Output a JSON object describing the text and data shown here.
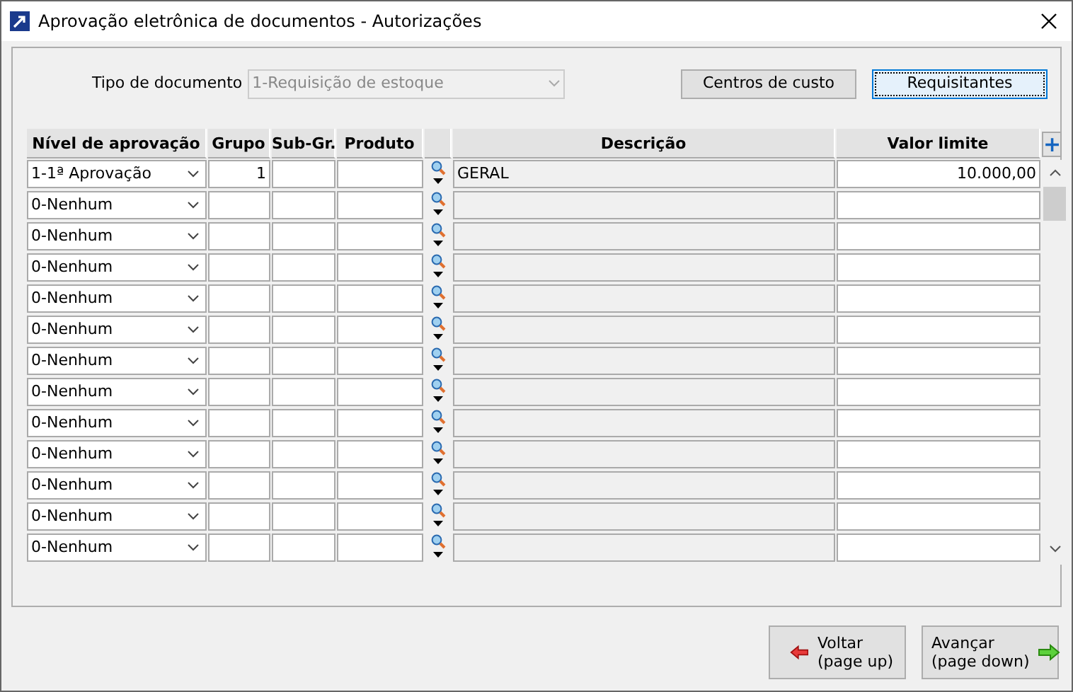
{
  "window": {
    "title": "Aprovação eletrônica de documentos - Autorizações"
  },
  "document_type": {
    "label": "Tipo de documento",
    "value": "1-Requisição de estoque",
    "disabled": true
  },
  "top_buttons": [
    {
      "label": "Centros de custo",
      "focused": false
    },
    {
      "label": "Requisitantes",
      "focused": true
    }
  ],
  "table": {
    "columns": [
      "Nível de aprovação",
      "Grupo",
      "Sub-Gr.",
      "Produto",
      "Descrição",
      "Valor limite"
    ],
    "add_button": "+",
    "rows": [
      {
        "nivel": "1-1ª Aprovação",
        "grupo": "1",
        "subgrupo": "",
        "produto": "",
        "descricao": "GERAL",
        "valor": "10.000,00"
      },
      {
        "nivel": "0-Nenhum"
      },
      {
        "nivel": "0-Nenhum"
      },
      {
        "nivel": "0-Nenhum"
      },
      {
        "nivel": "0-Nenhum"
      },
      {
        "nivel": "0-Nenhum"
      },
      {
        "nivel": "0-Nenhum"
      },
      {
        "nivel": "0-Nenhum"
      },
      {
        "nivel": "0-Nenhum"
      },
      {
        "nivel": "0-Nenhum"
      },
      {
        "nivel": "0-Nenhum"
      },
      {
        "nivel": "0-Nenhum"
      },
      {
        "nivel": "0-Nenhum"
      }
    ]
  },
  "nav_buttons": [
    {
      "kind": "back",
      "label": "Voltar",
      "hint": "(page up)"
    },
    {
      "kind": "forward",
      "label": "Avançar",
      "hint": "(page down)"
    }
  ]
}
